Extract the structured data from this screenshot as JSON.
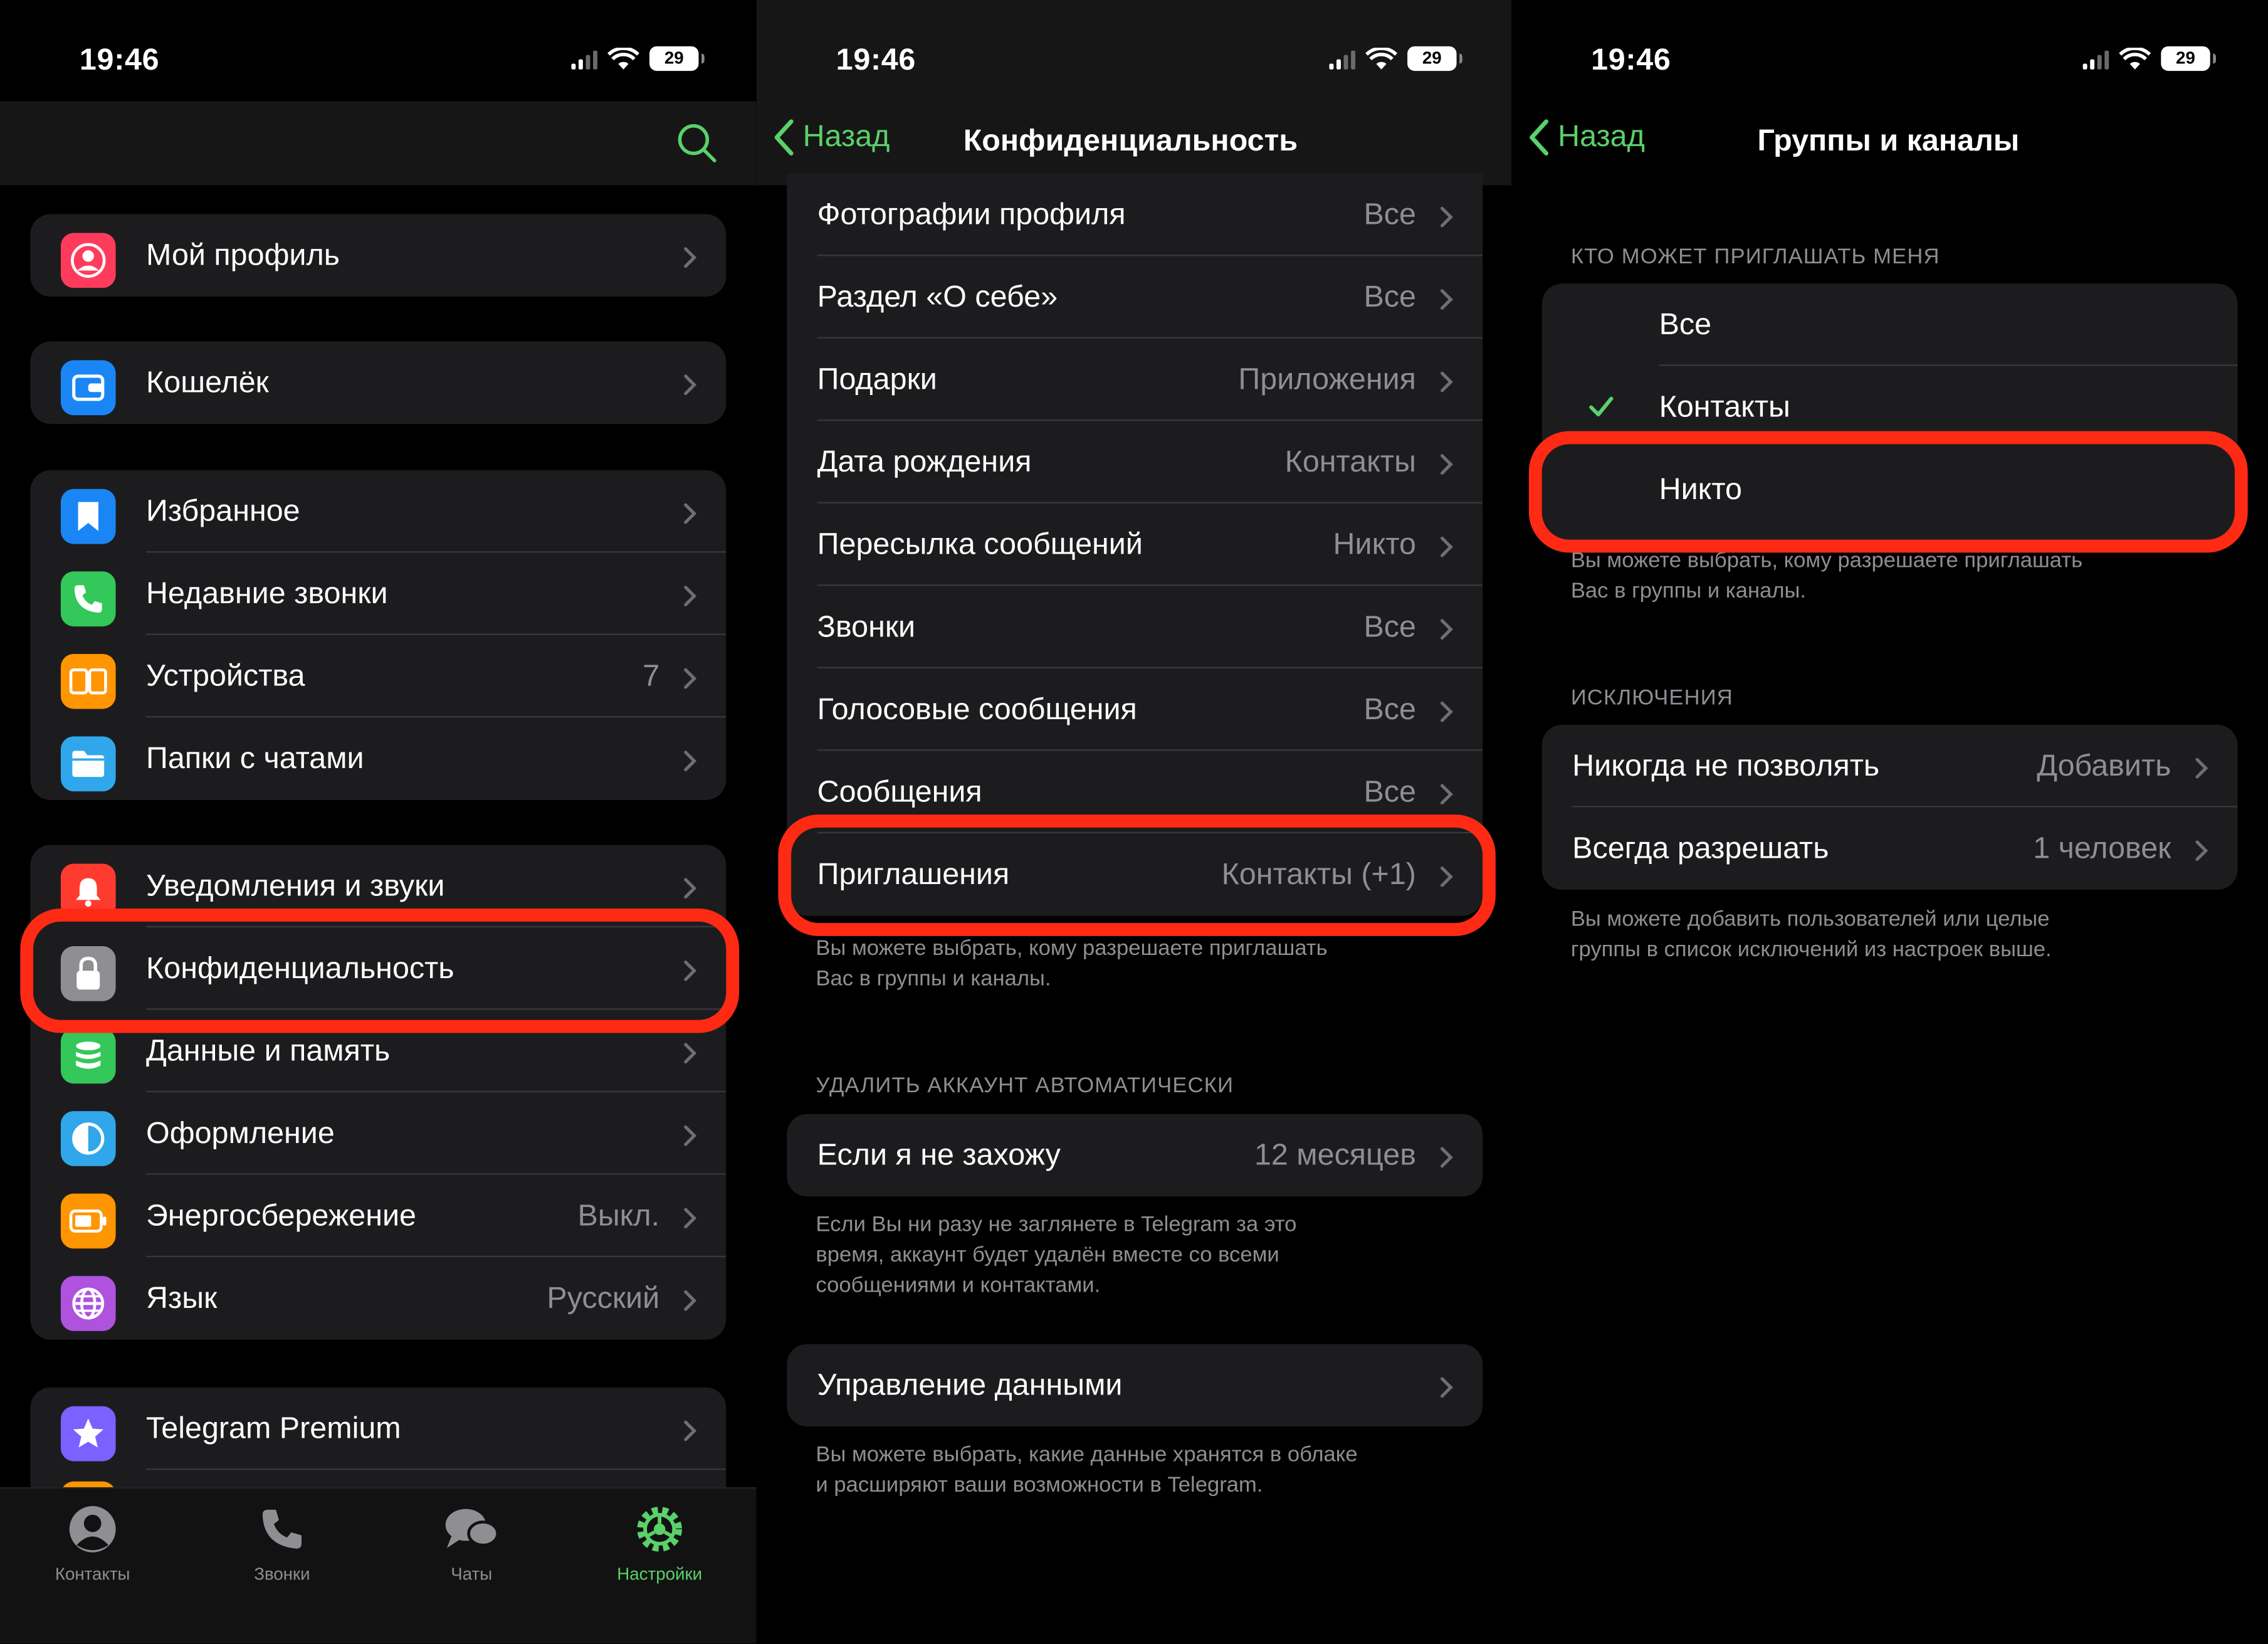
{
  "status": {
    "time": "19:46",
    "battery": "29"
  },
  "panel1": {
    "groups": [
      {
        "items": [
          {
            "label": "Мой профиль",
            "icon": "person-icon",
            "color": "#ff3b5c"
          }
        ]
      },
      {
        "items": [
          {
            "label": "Кошелёк",
            "icon": "wallet-icon",
            "color": "#1a86f5"
          }
        ]
      },
      {
        "items": [
          {
            "label": "Избранное",
            "icon": "bookmark-icon",
            "color": "#1a86f5"
          },
          {
            "label": "Недавние звонки",
            "icon": "phone-icon",
            "color": "#34c759"
          },
          {
            "label": "Устройства",
            "icon": "devices-icon",
            "color": "#ff9500",
            "value": "7"
          },
          {
            "label": "Папки с чатами",
            "icon": "folder-icon",
            "color": "#30a7ea"
          }
        ]
      },
      {
        "items": [
          {
            "label": "Уведомления и звуки",
            "icon": "bell-icon",
            "color": "#ff3b30"
          },
          {
            "label": "Конфиденциальность",
            "icon": "lock-icon",
            "color": "#8e8e93"
          },
          {
            "label": "Данные и память",
            "icon": "database-icon",
            "color": "#34c759"
          },
          {
            "label": "Оформление",
            "icon": "appearance-icon",
            "color": "#30a7ea"
          },
          {
            "label": "Энергосбережение",
            "icon": "battery-icon",
            "color": "#ff9500",
            "value": "Выкл."
          },
          {
            "label": "Язык",
            "icon": "globe-icon",
            "color": "#af52de",
            "value": "Русский"
          }
        ]
      },
      {
        "items": [
          {
            "label": "Telegram Premium",
            "icon": "star-icon",
            "color": "#7b61ff"
          }
        ]
      }
    ],
    "tabs": [
      {
        "label": "Контакты",
        "icon": "contacts-icon"
      },
      {
        "label": "Звонки",
        "icon": "calls-icon"
      },
      {
        "label": "Чаты",
        "icon": "chats-icon"
      },
      {
        "label": "Настройки",
        "icon": "settings-icon",
        "active": true
      }
    ]
  },
  "panel2": {
    "back": "Назад",
    "title": "Конфиденциальность",
    "rows": [
      {
        "label": "Фотографии профиля",
        "value": "Все"
      },
      {
        "label": "Раздел «О себе»",
        "value": "Все"
      },
      {
        "label": "Подарки",
        "value": "Приложения"
      },
      {
        "label": "Дата рождения",
        "value": "Контакты"
      },
      {
        "label": "Пересылка сообщений",
        "value": "Никто"
      },
      {
        "label": "Звонки",
        "value": "Все"
      },
      {
        "label": "Голосовые сообщения",
        "value": "Все"
      },
      {
        "label": "Сообщения",
        "value": "Все"
      },
      {
        "label": "Приглашения",
        "value": "Контакты (+1)"
      }
    ],
    "invites_footer": "Вы можете выбрать, кому разрешаете приглашать\nВас в группы и каналы.",
    "delete_header": "УДАЛИТЬ АККАУНТ АВТОМАТИЧЕСКИ",
    "delete_row": {
      "label": "Если я не захожу",
      "value": "12 месяцев"
    },
    "delete_footer": "Если Вы ни разу не заглянете в Telegram за это\nвремя, аккаунт будет удалён вместе со всеми\nсообщениями и контактами.",
    "data_row": {
      "label": "Управление данными"
    },
    "data_footer": "Вы можете выбрать, какие данные хранятся в облаке\nи расширяют ваши возможности в Telegram."
  },
  "panel3": {
    "back": "Назад",
    "title": "Группы и каналы",
    "who_header": "КТО МОЖЕТ ПРИГЛАШАТЬ МЕНЯ",
    "options": [
      {
        "label": "Все",
        "checked": false
      },
      {
        "label": "Контакты",
        "checked": true
      },
      {
        "label": "Никто",
        "checked": false
      }
    ],
    "who_footer": "Вы можете выбрать, кому разрешаете приглашать\nВас в группы и каналы.",
    "exc_header": "ИСКЛЮЧЕНИЯ",
    "exceptions": [
      {
        "label": "Никогда не позволять",
        "value": "Добавить"
      },
      {
        "label": "Всегда разрешать",
        "value": "1 человек"
      }
    ],
    "exc_footer": "Вы можете добавить пользователей или целые\nгруппы в список исключений из настроек выше."
  },
  "colors": {
    "accent": "#5ad16a",
    "highlight": "#ff2a14"
  }
}
